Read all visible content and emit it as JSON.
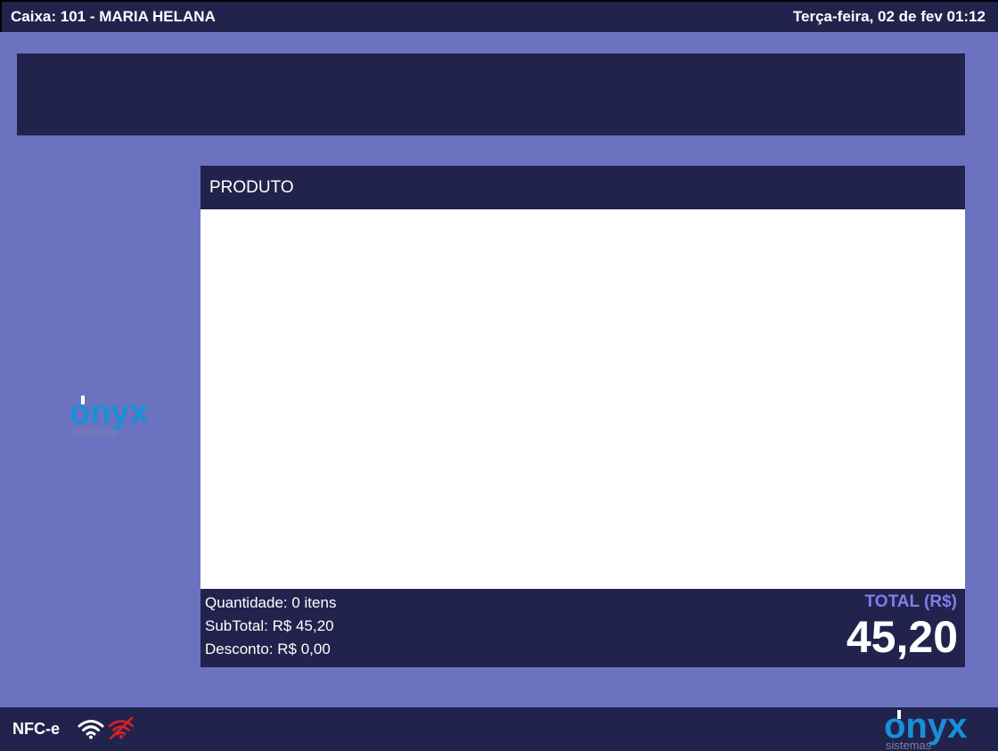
{
  "topbar": {
    "cashier": "Caixa: 101 - MARIA HELANA",
    "datetime": "Terça-feira, 02 de fev 01:12"
  },
  "product_panel": {
    "header": "PRODUTO"
  },
  "summary": {
    "quantity": "Quantidade: 0 itens",
    "subtotal": "SubTotal: R$ 45,20",
    "discount": "Desconto: R$ 0,00",
    "total_label": "TOTAL (R$)",
    "total_value": "45,20"
  },
  "footer": {
    "mode": "NFC-e",
    "icons": [
      "wifi-icon",
      "wifi-off-icon"
    ]
  },
  "brand": {
    "logo_text": "onyx",
    "logo_subtext": "sistemas"
  },
  "colors": {
    "background": "#6b73c1",
    "dark": "#21234d",
    "accent": "#7c80e8",
    "logo_blue": "#1a8fd6",
    "alert_red": "#e02020"
  }
}
